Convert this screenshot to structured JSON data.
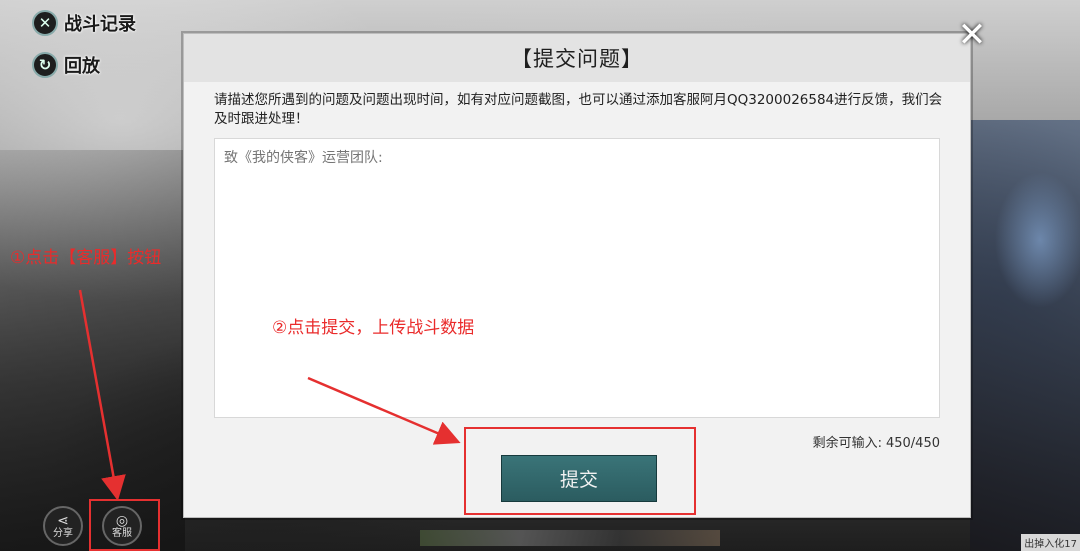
{
  "game": {
    "top_buttons": [
      {
        "label": "战斗记录",
        "icon": "crossed-swords-icon"
      },
      {
        "label": "回放",
        "icon": "replay-icon"
      }
    ],
    "bottom_buttons": [
      {
        "label": "分享",
        "icon": "share-icon"
      },
      {
        "label": "客服",
        "icon": "service-icon"
      }
    ],
    "corner_text": "出掉入化17"
  },
  "dialog": {
    "title": "【提交问题】",
    "description": "请描述您所遇到的问题及问题出现时间，如有对应问题截图，也可以通过添加客服阿月QQ3200026584进行反馈，我们会及时跟进处理！",
    "input_placeholder": "致《我的侠客》运营团队:",
    "remaining_label": "剩余可输入:",
    "remaining_value": "450/450",
    "submit_label": "提交",
    "close_icon": "close-icon"
  },
  "annotations": {
    "step1": "①点击【客服】按钮",
    "step2": "②点击提交，上传战斗数据",
    "color": "#e53030"
  }
}
